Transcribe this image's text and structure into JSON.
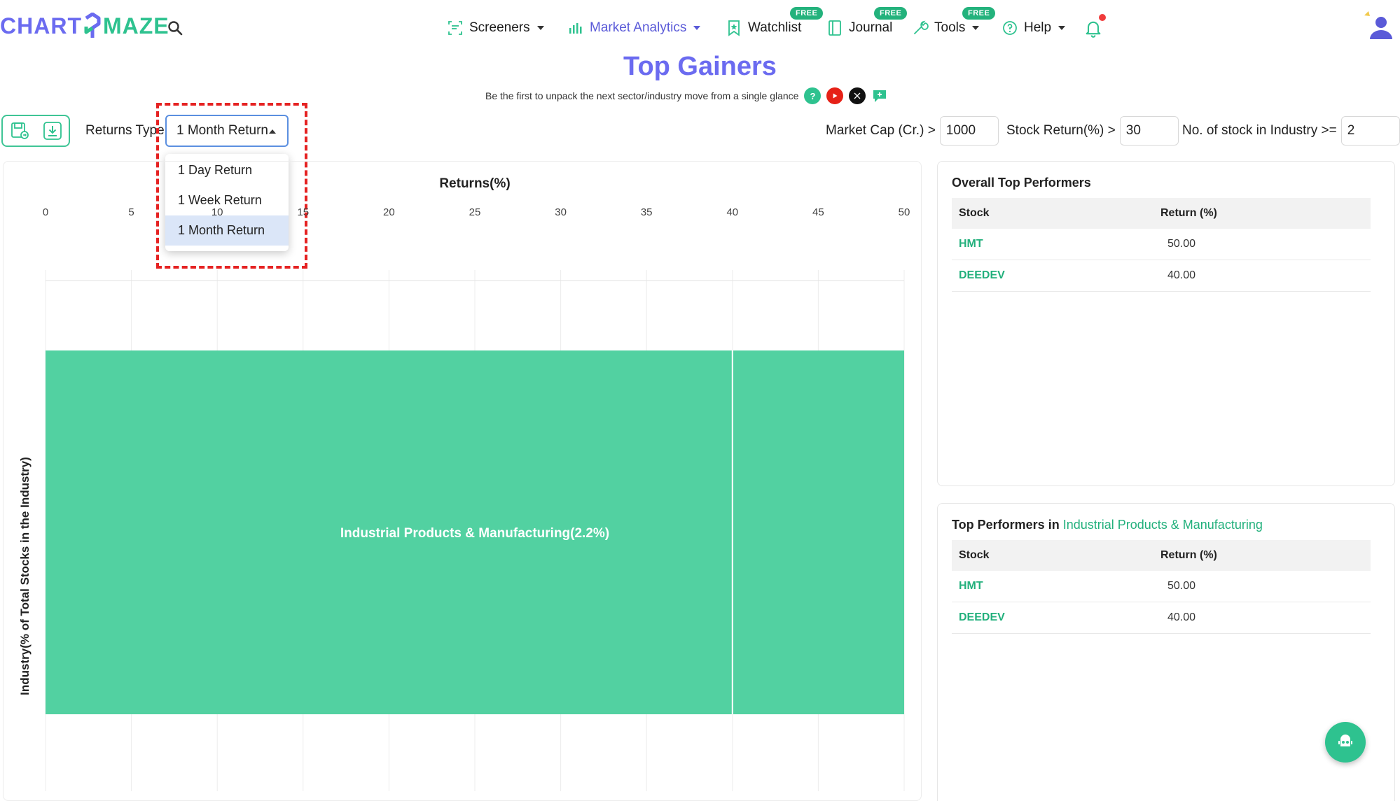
{
  "brand": {
    "part1": "CHART",
    "part2": "MAZE"
  },
  "nav": {
    "screeners": "Screeners",
    "market_analytics": "Market Analytics",
    "watchlist": "Watchlist",
    "journal": "Journal",
    "tools": "Tools",
    "help": "Help",
    "free_badge": "FREE"
  },
  "page": {
    "title": "Top Gainers",
    "subtitle": "Be the first to unpack the next sector/industry move from a single glance"
  },
  "controls": {
    "returns_type_label": "Returns Type",
    "returns_type_value": "1 Month Return",
    "options": [
      "1 Day Return",
      "1 Week Return",
      "1 Month Return"
    ],
    "selected_option_index": 2
  },
  "filters": {
    "market_cap_label": "Market Cap (Cr.) >",
    "market_cap_value": "1000",
    "stock_return_label": "Stock Return(%) >",
    "stock_return_value": "30",
    "stocks_in_industry_label": "No. of stock in Industry >=",
    "stocks_in_industry_value": "2"
  },
  "chart_data": {
    "type": "bar",
    "orientation": "horizontal",
    "xlabel": "Returns(%)",
    "ylabel": "Industry(% of Total Stocks in the Industry)",
    "xlim": [
      0,
      50
    ],
    "xticks": [
      0,
      5,
      10,
      15,
      20,
      25,
      30,
      35,
      40,
      45,
      50
    ],
    "xtick_labels": [
      "0",
      "5",
      "10",
      "15",
      "20",
      "25",
      "30",
      "35",
      "40",
      "45",
      "50"
    ],
    "categories": [
      "Industrial Products & Manufacturing(2.2%)"
    ],
    "segments": [
      {
        "stock": "DEEDEV",
        "value": 40
      },
      {
        "stock": "HMT",
        "value": 50
      }
    ],
    "values": [
      50
    ],
    "bar_color": "#52d1a1",
    "grid": true
  },
  "overall_top": {
    "title": "Overall Top Performers",
    "col_stock": "Stock",
    "col_return": "Return (%)",
    "rows": [
      {
        "stock": "HMT",
        "ret": "50.00"
      },
      {
        "stock": "DEEDEV",
        "ret": "40.00"
      }
    ]
  },
  "industry_top": {
    "title_prefix": "Top Performers in ",
    "industry": "Industrial Products & Manufacturing",
    "col_stock": "Stock",
    "col_return": "Return (%)",
    "rows": [
      {
        "stock": "HMT",
        "ret": "50.00"
      },
      {
        "stock": "DEEDEV",
        "ret": "40.00"
      }
    ]
  },
  "colors": {
    "brand_purple": "#6b6bf0",
    "brand_green": "#2ec28f",
    "highlight_red": "#e52222"
  }
}
